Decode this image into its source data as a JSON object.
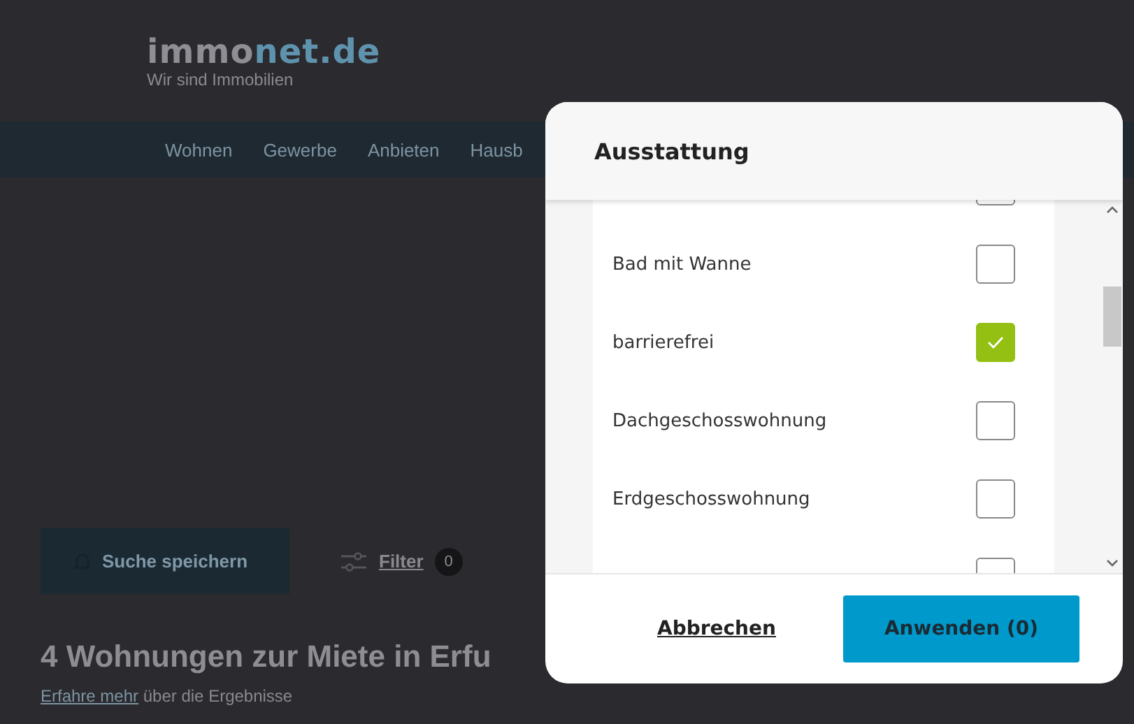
{
  "header": {
    "logo": [
      "immo",
      "net.de"
    ],
    "tagline": "Wir sind Immobilien"
  },
  "nav": [
    "Wohnen",
    "Gewerbe",
    "Anbieten",
    "Hausb"
  ],
  "toolbar": {
    "save_search": "Suche speichern",
    "filter": "Filter",
    "filter_count": "0"
  },
  "results": {
    "heading": "4 Wohnungen zur Miete in Erfu",
    "link": "Erfahre mehr",
    "text": " über die Ergebnisse"
  },
  "modal": {
    "title": "Ausstattung",
    "items": [
      {
        "checked": false
      },
      {
        "label": "Bad mit Wanne",
        "checked": false
      },
      {
        "label": "barrierefrei",
        "checked": true
      },
      {
        "label": "Dachgeschosswohnung",
        "checked": false
      },
      {
        "label": "Erdgeschosswohnung",
        "checked": false
      },
      {
        "checked": false
      }
    ],
    "cancel": "Abbrechen",
    "apply": "Anwenden (0)"
  }
}
